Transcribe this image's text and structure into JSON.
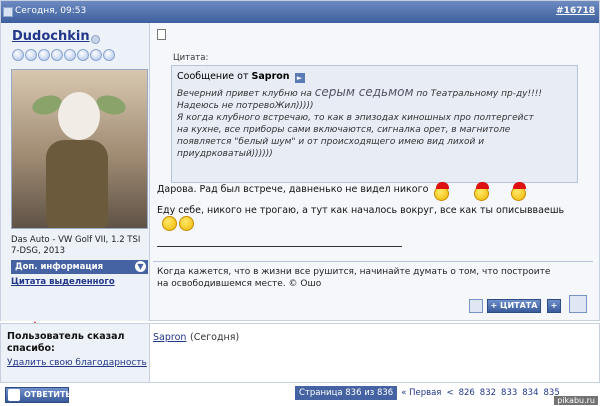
{
  "post": {
    "date": "Сегодня, 09:53",
    "number": "#16718",
    "user": {
      "name": "Dudochkin",
      "car": "Das Auto - VW Golf VII, 1.2 TSI 7-DSG, 2013",
      "more_info": "Доп. информация",
      "quote_selected": "Цитата выделенного"
    },
    "quote": {
      "label": "Цитата:",
      "from_prefix": "Сообщение от",
      "author": "Sapron",
      "line1_a": "Вечерний привет клубню на",
      "line1_big": "серым седьмом",
      "line1_b": "по Театральному пр-ду!!!!",
      "line2": "Надеюсь не потревоЖил)))))",
      "line3": "Я когда клубного встречаю, то как в эпизодах киношных про полтергейст",
      "line4": "на кухне, все приборы сами включаются, сигналка орет, в магнитоле",
      "line5": "появляется \"белый шум\" и от происходящего имею вид лихой и",
      "line6": "приудрковатый))))))"
    },
    "text1": "Дарова. Рад был встрече, давненько не видел никого",
    "text2": "Еду себе, никого не трогаю, а тут как началось вокруг, все как ты описывваешь",
    "signature_line1": "Когда кажется, что в жизни все рушится, начинайте думать о том, что построите",
    "signature_line2": "на освободившемся месте. © Ошо",
    "quote_button": "+ ЦИТАТА",
    "plus_button": "+"
  },
  "thanks": {
    "title": "Пользователь сказал спасибо:",
    "undo": "Удалить свою благодарность",
    "user": "Sapron",
    "when": "(Сегодня)"
  },
  "footer": {
    "reply": "ОТВЕТИТЬ",
    "page_info": "Страница 836 из 836",
    "first": "« Первая",
    "prev": "<",
    "pages": [
      "826",
      "832",
      "833",
      "834",
      "835"
    ],
    "watermark": "pikabu.ru"
  }
}
